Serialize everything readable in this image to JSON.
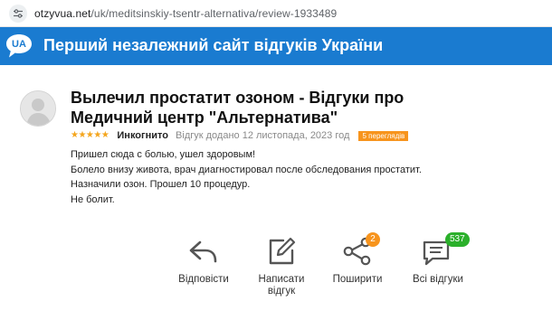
{
  "browser": {
    "url_host": "otzyvua.net",
    "url_path": "/uk/meditsinskiy-tsentr-alternativa/review-1933489"
  },
  "banner": {
    "logo_text": "UA",
    "title": "Перший незалежний сайт відгуків України"
  },
  "review": {
    "title": "Вылечил простатит озоном - Відгуки про Медичний центр \"Альтернатива\"",
    "stars": "★★★★★",
    "rating": 5,
    "author": "Инкогнито",
    "added": "Відгук додано 12 листопада, 2023 год",
    "views_badge": "5 переглядів",
    "body": [
      "Пришел сюда с болью, ушел здоровым!",
      "Болело внизу живота, врач диагностировал после обследования простатит.",
      "Назначили озон. Прошел 10 процедур.",
      "Не болит."
    ]
  },
  "actions": {
    "reply": {
      "label": "Відповісти",
      "icon": "reply-icon"
    },
    "write": {
      "label_line1": "Написати",
      "label_line2": "відгук",
      "icon": "edit-icon"
    },
    "share": {
      "label": "Поширити",
      "icon": "share-icon",
      "badge": "2"
    },
    "all": {
      "label": "Всі відгуки",
      "icon": "comments-icon",
      "badge": "537"
    }
  },
  "colors": {
    "brand_blue": "#1a7bd0",
    "star_orange": "#f4a51c",
    "badge_orange": "#f7941d",
    "badge_green": "#2bb02b",
    "icon_gray": "#555555"
  }
}
